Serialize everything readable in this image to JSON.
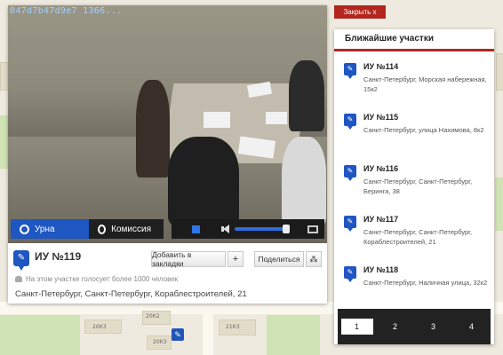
{
  "video": {
    "timestamp": "047d7b47d9e7 1366...",
    "tabs": [
      {
        "label": "Урна",
        "icon": "camera-icon",
        "active": true
      },
      {
        "label": "Комиссия",
        "icon": "camera-icon",
        "active": false
      }
    ],
    "volume_level": 0.8
  },
  "station": {
    "title": "ИУ №119",
    "bookmark_button": "Добавить в закладки",
    "plus_button": "+",
    "share_button": "Поделиться",
    "voters_note": "На этом участке голосует более 1000 человек",
    "address": "Санкт-Петербург, Санкт-Петербург, Кораблестроителей, 21"
  },
  "close_button": "Закрыть  x",
  "nearby": {
    "title": "Ближайшие участки",
    "items": [
      {
        "name": "ИУ №114",
        "address": "Санкт-Петербург, Морская набережная, 15к2"
      },
      {
        "name": "ИУ №115",
        "address": "Санкт-Петербург, улица Нахимова, 8к2"
      },
      {
        "name": "ИУ №116",
        "address": "Санкт-Петербург, Санкт-Петербург, Беринга, 38"
      },
      {
        "name": "ИУ №117",
        "address": "Санкт-Петербург, Санкт-Петербург, Кораблестроителей, 21"
      },
      {
        "name": "ИУ №118",
        "address": "Санкт-Петербург, Наличная улица, 32к2"
      }
    ],
    "pages": [
      "1",
      "2",
      "3",
      "4"
    ],
    "active_page": "1"
  },
  "map": {
    "house_labels": [
      "20К2",
      "20К3",
      "21К3",
      "20К3"
    ]
  },
  "colors": {
    "accent_blue": "#1f56c1",
    "accent_red": "#b3261e"
  }
}
